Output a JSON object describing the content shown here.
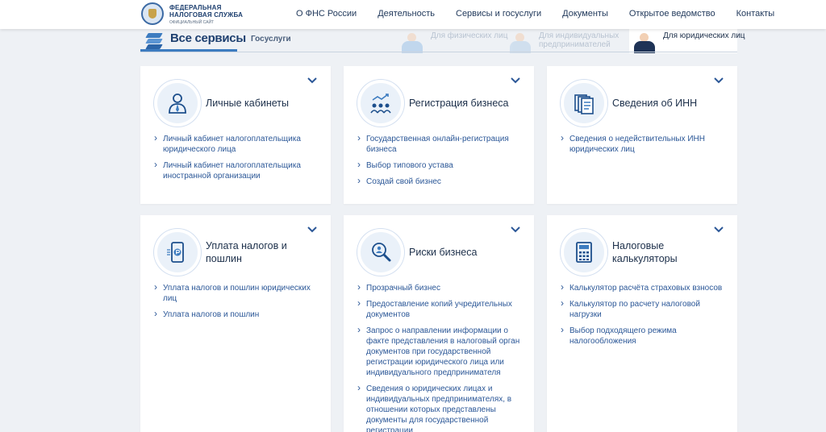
{
  "logo": {
    "line1": "ФЕДЕРАЛЬНАЯ",
    "line2": "НАЛОГОВАЯ СЛУЖБА",
    "line3": "ОФИЦИАЛЬНЫЙ САЙТ"
  },
  "nav": [
    "О ФНС России",
    "Деятельность",
    "Сервисы и госуслуги",
    "Документы",
    "Открытое ведомство",
    "Контакты"
  ],
  "services_bar": {
    "title": "Все сервисы",
    "gosuslugi": "Госуслуги",
    "segments": [
      {
        "label": "Для физических лиц",
        "active": false
      },
      {
        "label": "Для индивидуальных предпринимателей",
        "active": false
      },
      {
        "label": "Для юридических лиц",
        "active": true
      }
    ]
  },
  "cards": [
    {
      "title": "Личные кабинеты",
      "icon": "person-icon",
      "links": [
        "Личный кабинет налогоплательщика юридического лица",
        "Личный кабинет налогоплательщика иностранной организации"
      ]
    },
    {
      "title": "Регистрация бизнеса",
      "icon": "group-growth-icon",
      "links": [
        "Государственная онлайн-регистрация бизнеса",
        "Выбор типового устава",
        "Создай свой бизнес"
      ]
    },
    {
      "title": "Сведения об ИНН",
      "icon": "documents-icon",
      "links": [
        "Сведения о недействительных ИНН юридических лиц"
      ]
    },
    {
      "title": "Уплата налогов и пошлин",
      "icon": "phone-ruble-icon",
      "links": [
        "Уплата налогов и пошлин юридических лиц",
        "Уплата налогов и пошлин"
      ]
    },
    {
      "title": "Риски бизнеса",
      "icon": "magnifier-icon",
      "links": [
        "Прозрачный бизнес",
        "Предоставление копий учредительных документов",
        "Запрос о направлении информации о факте представления в налоговый орган документов при государственной регистрации юридического лица или индивидуального предпринимателя",
        "Сведения о юридических лицах и индивидуальных предпринимателях, в отношении которых представлены документы для государственной регистрации"
      ]
    },
    {
      "title": "Налоговые калькуляторы",
      "icon": "calculator-icon",
      "links": [
        "Калькулятор расчёта страховых взносов",
        "Калькулятор по расчету налоговой нагрузки",
        "Выбор подходящего режима налогообложения"
      ]
    }
  ]
}
